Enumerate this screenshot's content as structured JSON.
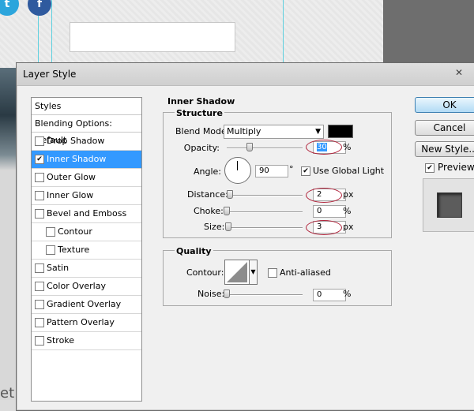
{
  "window": {
    "title": "Layer Style"
  },
  "styles_panel": {
    "header": "Styles",
    "blending_options": "Blending Options: Default",
    "items": [
      {
        "label": "Drop Shadow",
        "checked": false,
        "selected": false,
        "sub": false
      },
      {
        "label": "Inner Shadow",
        "checked": true,
        "selected": true,
        "sub": false
      },
      {
        "label": "Outer Glow",
        "checked": false,
        "selected": false,
        "sub": false
      },
      {
        "label": "Inner Glow",
        "checked": false,
        "selected": false,
        "sub": false
      },
      {
        "label": "Bevel and Emboss",
        "checked": false,
        "selected": false,
        "sub": false
      },
      {
        "label": "Contour",
        "checked": false,
        "selected": false,
        "sub": true
      },
      {
        "label": "Texture",
        "checked": false,
        "selected": false,
        "sub": true
      },
      {
        "label": "Satin",
        "checked": false,
        "selected": false,
        "sub": false
      },
      {
        "label": "Color Overlay",
        "checked": false,
        "selected": false,
        "sub": false
      },
      {
        "label": "Gradient Overlay",
        "checked": false,
        "selected": false,
        "sub": false
      },
      {
        "label": "Pattern Overlay",
        "checked": false,
        "selected": false,
        "sub": false
      },
      {
        "label": "Stroke",
        "checked": false,
        "selected": false,
        "sub": false
      }
    ]
  },
  "inner_shadow": {
    "section_title": "Inner Shadow",
    "structure": {
      "title": "Structure",
      "blend_mode_label": "Blend Mode:",
      "blend_mode_value": "Multiply",
      "color": "#000000",
      "opacity_label": "Opacity:",
      "opacity_value": "30",
      "opacity_unit": "%",
      "opacity_slider": 0.3,
      "angle_label": "Angle:",
      "angle_value": "90",
      "angle_unit": "°",
      "use_global_light_label": "Use Global Light",
      "use_global_light": true,
      "distance_label": "Distance:",
      "distance_value": "2",
      "distance_unit": "px",
      "choke_label": "Choke:",
      "choke_value": "0",
      "choke_unit": "%",
      "size_label": "Size:",
      "size_value": "3",
      "size_unit": "px"
    },
    "quality": {
      "title": "Quality",
      "contour_label": "Contour:",
      "anti_aliased_label": "Anti-aliased",
      "anti_aliased": false,
      "noise_label": "Noise:",
      "noise_value": "0",
      "noise_unit": "%"
    }
  },
  "buttons": {
    "ok": "OK",
    "cancel": "Cancel",
    "new_style": "New Style...",
    "preview_label": "Preview",
    "preview_checked": true
  },
  "background": {
    "partial_text": "et"
  },
  "colors": {
    "accent": "#3399ff",
    "annotation_oval": "#b0223a",
    "guide": "#5fd0df"
  }
}
